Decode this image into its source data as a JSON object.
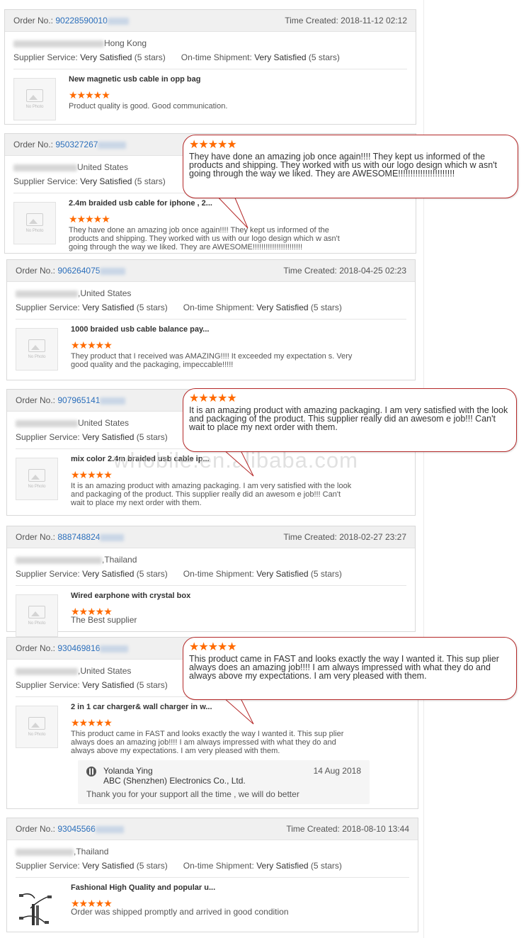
{
  "labels": {
    "order_no": "Order No.:",
    "time_created": "Time Created:",
    "supplier_service": "Supplier Service:",
    "ontime_shipment": "On-time Shipment:",
    "rating_text": "Very Satisfied",
    "rating_count": "(5 stars)",
    "no_photo": "No Photo"
  },
  "stars": "★★★★★",
  "star_color": "#ff6a00",
  "accent_blue": "#2a6ebb",
  "bubble_border": "#b52a2a",
  "watermark": "whobile.en.alibaba.com",
  "orders": [
    {
      "order_no": "90228590010",
      "time": "2018-11-12 02:12",
      "country": "Hong Kong",
      "product": "New magnetic usb cable in opp bag",
      "review": "Product quality is good. Good communication."
    },
    {
      "order_no": "950327267",
      "time": "",
      "country": "United States",
      "product": "2.4m braided usb cable for iphone , 2...",
      "review": "They have done an amazing job once again!!!! They kept us informed of the products and shipping.  They worked with us with our logo design which w asn't going through the way we liked.  They are AWESOME!!!!!!!!!!!!!!!!!!!!!!!"
    },
    {
      "order_no": "906264075",
      "time": "2018-04-25 02:23",
      "country": "United States",
      "product": "1000 braided usb cable balance pay...",
      "review": "They product that I received was AMAZING!!!! It exceeded my expectation s.  Very good quality and the packaging, impeccable!!!!!"
    },
    {
      "order_no": "907965141",
      "time": "",
      "country": "United States",
      "product": "mix color 2.4m braided usb cable ip...",
      "review": "It is an amazing product with amazing packaging.  I am very satisfied with the look and packaging of the product.  This supplier really did an awesom e job!!!  Can't wait to place my next order with them."
    },
    {
      "order_no": "888748824",
      "time": "2018-02-27 23:27",
      "country": "Thailand",
      "product": "Wired earphone with crystal box",
      "review": "The Best supplier"
    },
    {
      "order_no": "930469816",
      "time": "",
      "country": "United States",
      "product": "2 in 1 car charger& wall charger in w...",
      "review": "This product came in FAST and looks exactly the way I wanted it.  This sup plier always does an amazing job!!!! I am always impressed with what they do and always above my expectations.  I am very pleased with them.",
      "reply": {
        "name": "Yolanda Ying",
        "company": "ABC (Shenzhen) Electronics Co., Ltd.",
        "date": "14 Aug 2018",
        "text": "Thank you for your support all the time , we will do better"
      }
    },
    {
      "order_no": "93045566",
      "time": "2018-08-10 13:44",
      "country": "Thailand",
      "product": "Fashional High Quality and popular u...",
      "review": "Order was shipped promptly and arrived in good condition"
    }
  ],
  "bubbles": [
    {
      "text": "They have done an amazing job once again!!!! They kept us informed of the products and shipping.  They worked with us with our logo design which w asn't going through the way we liked.  They are AWESOME!!!!!!!!!!!!!!!!!!!!!!!"
    },
    {
      "text": "It is an amazing product with amazing packaging.  I am very satisfied with the look and packaging of the product.  This supplier really did an awesom e job!!!  Can't wait to place my next order with them."
    },
    {
      "text": "This product came in FAST and looks exactly the way I wanted it.  This sup plier always does an amazing job!!!! I am always impressed with what they do and always above my expectations.  I am very pleased with them."
    }
  ]
}
